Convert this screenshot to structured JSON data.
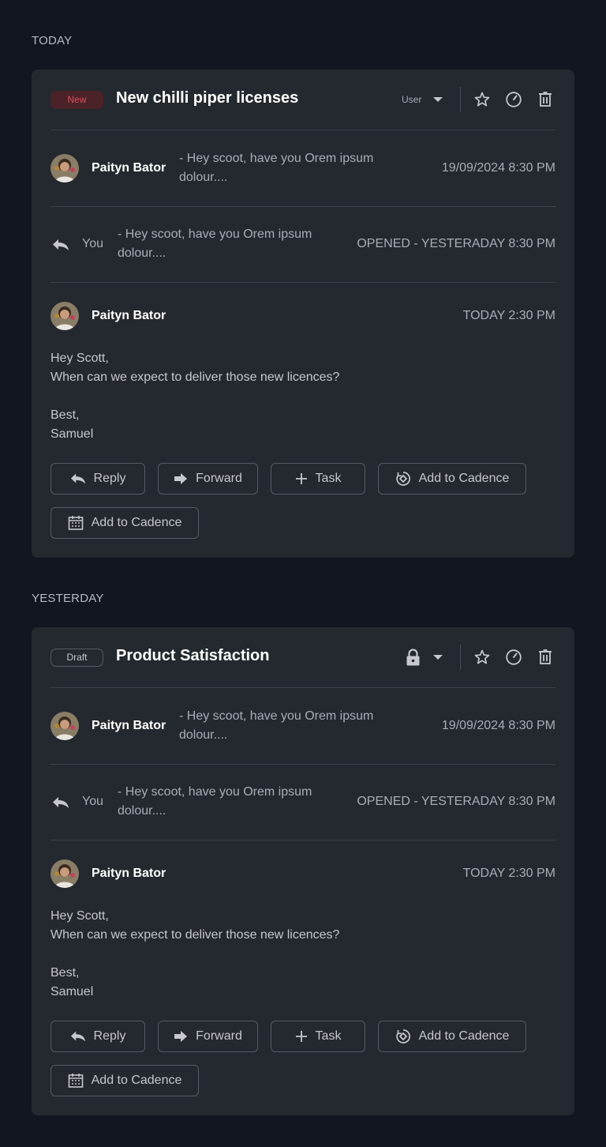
{
  "sections": [
    {
      "label": "TODAY",
      "card": {
        "badge": "New",
        "title": "New chilli piper licenses",
        "user_label": "User",
        "messages": [
          {
            "sender": "Paityn Bator",
            "preview_line1": "- Hey scoot, have you Orem ipsum",
            "preview_line2": "dolour....",
            "timestamp": "19/09/2024 8:30 PM"
          }
        ],
        "reply": {
          "sender": "You",
          "preview_line1": "- Hey scoot, have you Orem ipsum",
          "preview_line2": "dolour....",
          "status": "OPENED - YESTERADAY 8:30 PM"
        },
        "open_message": {
          "sender": "Paityn Bator",
          "timestamp": "TODAY 2:30 PM",
          "body": [
            "Hey Scott,",
            "When can we expect to deliver those new licences?",
            "",
            "Best,",
            "Samuel"
          ]
        },
        "actions": [
          "Reply",
          "Forward",
          "Task",
          "Add to Cadence",
          "Add to Cadence"
        ]
      }
    },
    {
      "label": "YESTERDAY",
      "card": {
        "badge": "Draft",
        "title": "Product Satisfaction",
        "messages": [
          {
            "sender": "Paityn Bator",
            "preview_line1": "- Hey scoot, have you Orem ipsum",
            "preview_line2": "dolour....",
            "timestamp": "19/09/2024 8:30 PM"
          }
        ],
        "reply": {
          "sender": "You",
          "preview_line1": "- Hey scoot, have you Orem ipsum",
          "preview_line2": "dolour....",
          "status": "OPENED - YESTERADAY 8:30 PM"
        },
        "open_message": {
          "sender": "Paityn Bator",
          "timestamp": "TODAY 2:30 PM",
          "body": [
            "Hey Scott,",
            "When can we expect to deliver those new licences?",
            "",
            "Best,",
            "Samuel"
          ]
        },
        "actions": [
          "Reply",
          "Forward",
          "Task",
          "Add to Cadence",
          "Add to Cadence"
        ]
      }
    }
  ],
  "icons": {
    "header": [
      "caret-down-icon",
      "star-icon",
      "speedometer-icon",
      "trash-icon",
      "lock-icon"
    ],
    "actions": [
      "reply-icon",
      "forward-icon",
      "plus-icon",
      "cadence-icon",
      "calendar-icon"
    ]
  },
  "colors": {
    "background": "#111620",
    "card": "#24292f",
    "new_badge_bg": "#4a2227",
    "new_badge_text": "#e0505e"
  }
}
